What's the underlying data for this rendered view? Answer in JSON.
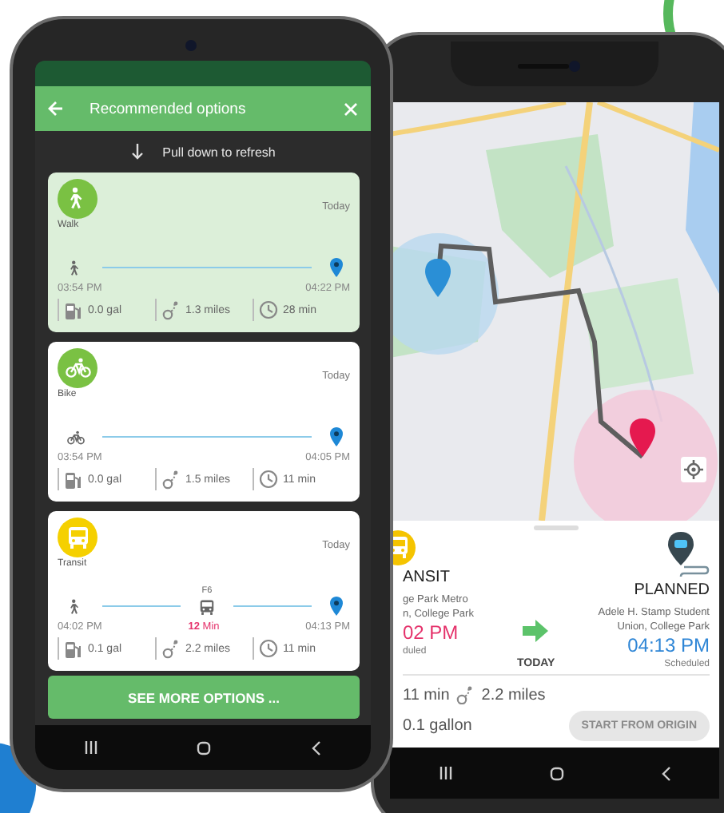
{
  "left_phone": {
    "header": {
      "title": "Recommended options"
    },
    "pull_hint": "Pull down to refresh",
    "options": [
      {
        "kind": "walk",
        "mode": "Walk",
        "day": "Today",
        "selected": true,
        "depart": "03:54 PM",
        "arrive": "04:22 PM",
        "fuel": "0.0 gal",
        "distance": "1.3 miles",
        "duration": "28 min"
      },
      {
        "kind": "bike",
        "mode": "Bike",
        "day": "Today",
        "selected": false,
        "depart": "03:54 PM",
        "arrive": "04:05 PM",
        "fuel": "0.0 gal",
        "distance": "1.5 miles",
        "duration": "11 min"
      },
      {
        "kind": "transit",
        "mode": "Transit",
        "day": "Today",
        "selected": false,
        "line": "F6",
        "wait": "**12** Min",
        "depart": "04:02 PM",
        "arrive": "04:13 PM",
        "fuel": "0.1 gal",
        "distance": "2.2 miles",
        "duration": "11 min"
      }
    ],
    "more_button": "SEE MORE OPTIONS ..."
  },
  "right_phone": {
    "trip": {
      "origin": {
        "mode": "ANSIT",
        "place": [
          "ge Park Metro",
          "n, College Park"
        ],
        "time": "02 PM",
        "status": "duled"
      },
      "day": "TODAY",
      "destination": {
        "mode": "PLANNED",
        "place": [
          "Adele H. Stamp Student",
          "Union, College Park"
        ],
        "time": "04:13 PM",
        "status": "Scheduled"
      },
      "duration": "11 min",
      "distance": "2.2 miles",
      "fuel": "0.1 gallon",
      "start_button": {
        "label": "START FROM ORIGIN",
        "disabled": true
      }
    }
  }
}
